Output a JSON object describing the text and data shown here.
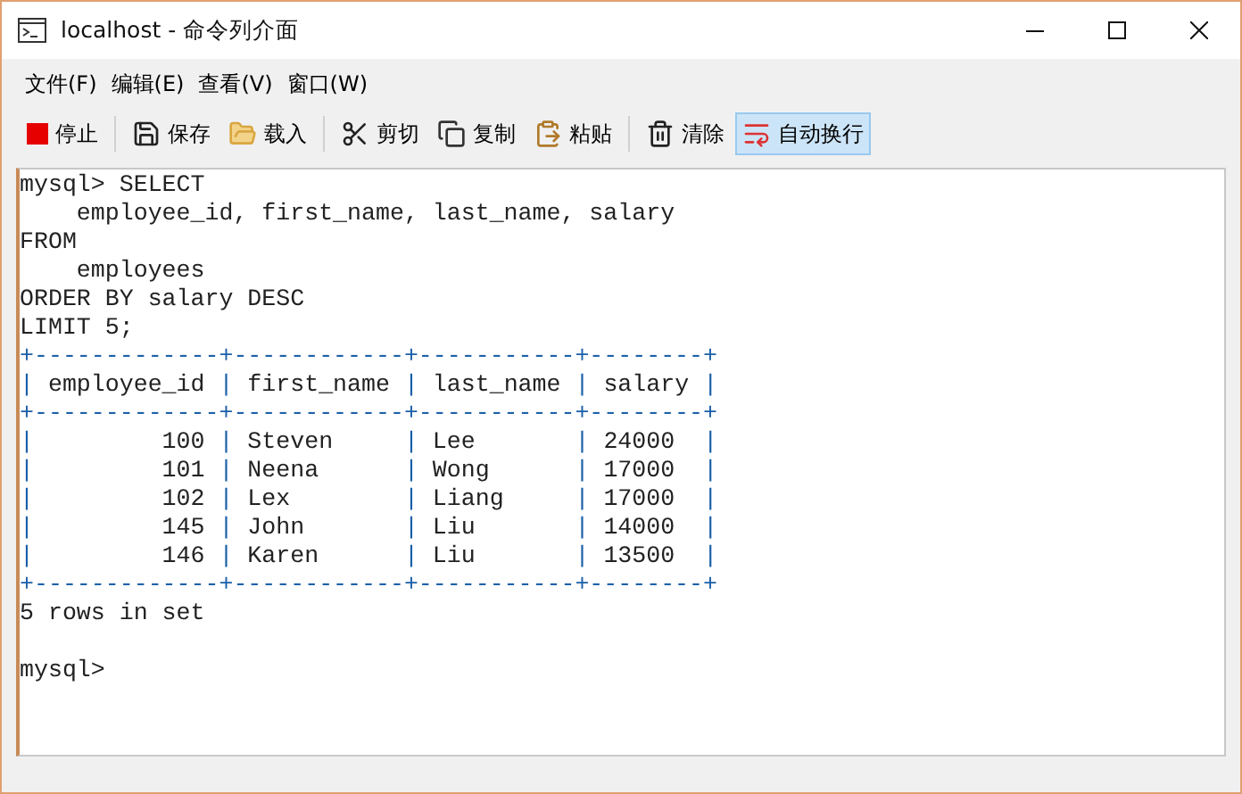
{
  "window": {
    "title": "localhost - 命令列介面"
  },
  "menu": [
    "文件(F)",
    "编辑(E)",
    "查看(V)",
    "窗口(W)"
  ],
  "toolbar": [
    [
      {
        "label": "停止",
        "selected": false
      }
    ],
    [
      {
        "label": "保存",
        "selected": false
      },
      {
        "label": "载入",
        "selected": false
      }
    ],
    [
      {
        "label": "剪切",
        "selected": false
      },
      {
        "label": "复制",
        "selected": false
      },
      {
        "label": "粘贴",
        "selected": false
      }
    ],
    [
      {
        "label": "清除",
        "selected": false
      },
      {
        "label": "自动换行",
        "selected": true
      }
    ]
  ],
  "console": {
    "lines": [
      {
        "kind": "text",
        "text": "mysql> SELECT"
      },
      {
        "kind": "text",
        "text": "    employee_id, first_name, last_name, salary"
      },
      {
        "kind": "text",
        "text": "FROM"
      },
      {
        "kind": "text",
        "text": "    employees"
      },
      {
        "kind": "text",
        "text": "ORDER BY salary DESC"
      },
      {
        "kind": "text",
        "text": "LIMIT 5;"
      },
      {
        "kind": "table",
        "text": "+-------------+------------+-----------+--------+"
      },
      {
        "kind": "table",
        "text": "| employee_id | first_name | last_name | salary |"
      },
      {
        "kind": "table",
        "text": "+-------------+------------+-----------+--------+"
      },
      {
        "kind": "table",
        "text": "|         100 | Steven     | Lee       | 24000  |"
      },
      {
        "kind": "table",
        "text": "|         101 | Neena      | Wong      | 17000  |"
      },
      {
        "kind": "table",
        "text": "|         102 | Lex        | Liang     | 17000  |"
      },
      {
        "kind": "table",
        "text": "|         145 | John       | Liu       | 14000  |"
      },
      {
        "kind": "table",
        "text": "|         146 | Karen      | Liu       | 13500  |"
      },
      {
        "kind": "table",
        "text": "+-------------+------------+-----------+--------+"
      },
      {
        "kind": "text",
        "text": "5 rows in set"
      },
      {
        "kind": "blank"
      },
      {
        "kind": "text",
        "text": "mysql>"
      }
    ]
  }
}
